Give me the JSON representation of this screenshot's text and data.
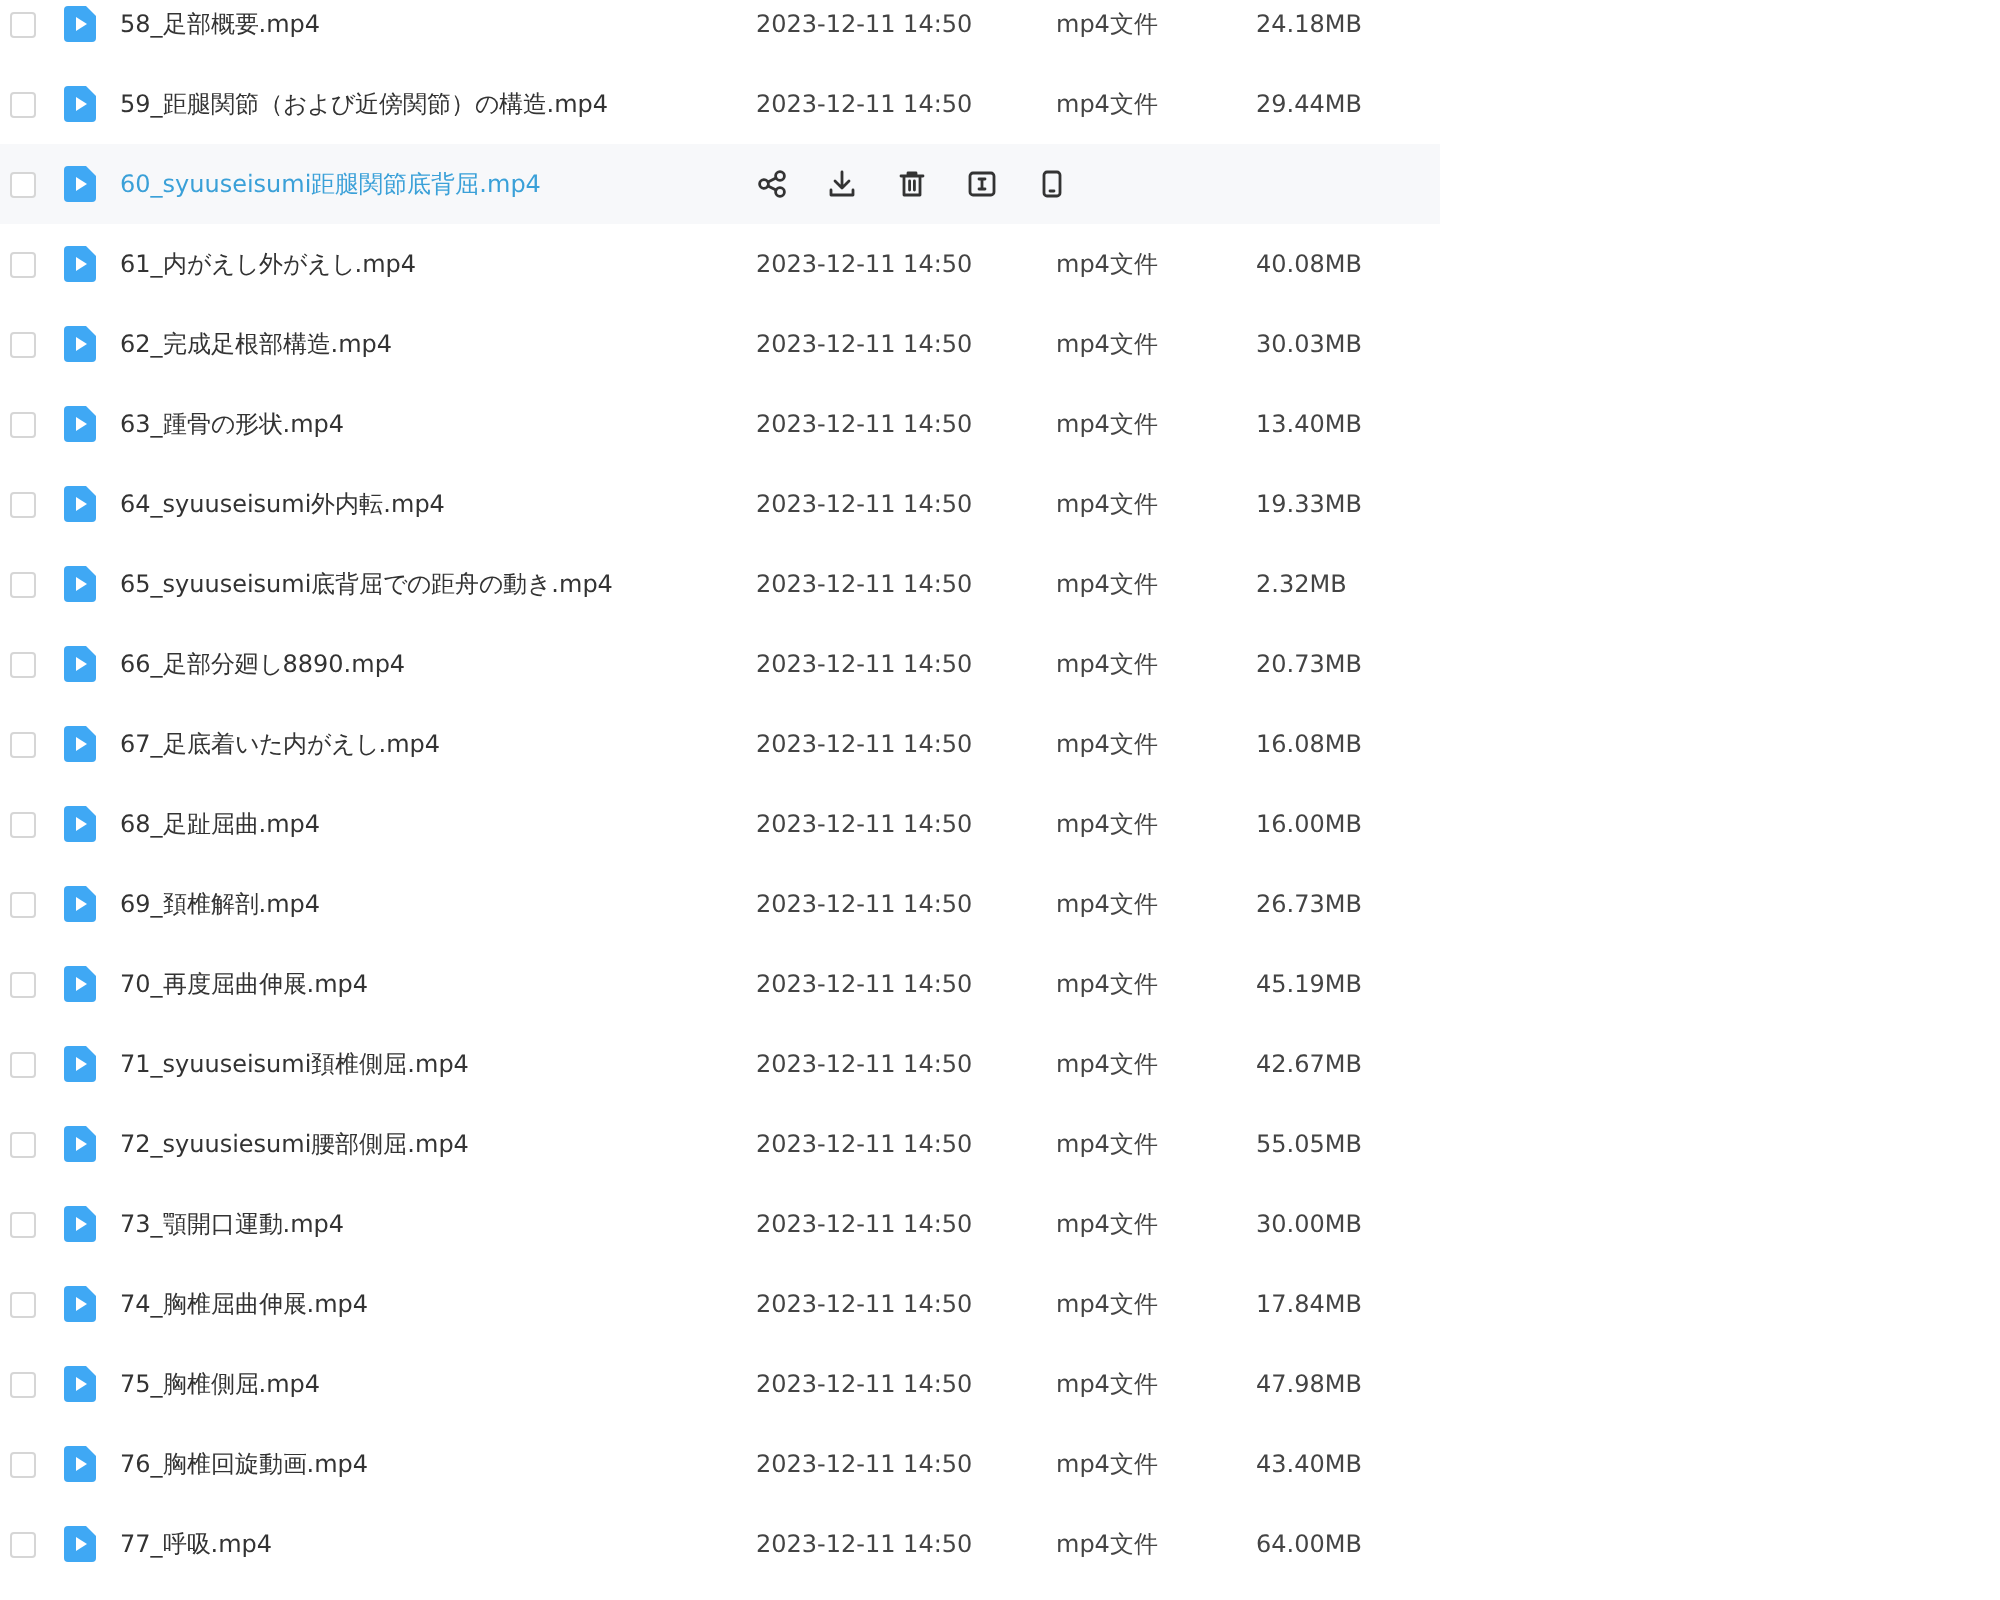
{
  "files": [
    {
      "name": "58_足部概要.mp4",
      "date": "2023-12-11 14:50",
      "type": "mp4文件",
      "size": "24.18MB",
      "hovered": false,
      "checked": false
    },
    {
      "name": "59_距腿関節（および近傍関節）の構造.mp4",
      "date": "2023-12-11 14:50",
      "type": "mp4文件",
      "size": "29.44MB",
      "hovered": false,
      "checked": false
    },
    {
      "name": "60_syuuseisumi距腿関節底背屈.mp4",
      "hovered": true,
      "checked": false
    },
    {
      "name": "61_内がえし外がえし.mp4",
      "date": "2023-12-11 14:50",
      "type": "mp4文件",
      "size": "40.08MB",
      "hovered": false,
      "checked": false
    },
    {
      "name": "62_完成足根部構造.mp4",
      "date": "2023-12-11 14:50",
      "type": "mp4文件",
      "size": "30.03MB",
      "hovered": false,
      "checked": false
    },
    {
      "name": "63_踵骨の形状.mp4",
      "date": "2023-12-11 14:50",
      "type": "mp4文件",
      "size": "13.40MB",
      "hovered": false,
      "checked": false
    },
    {
      "name": "64_syuuseisumi外内転.mp4",
      "date": "2023-12-11 14:50",
      "type": "mp4文件",
      "size": "19.33MB",
      "hovered": false,
      "checked": false
    },
    {
      "name": "65_syuuseisumi底背屈での距舟の動き.mp4",
      "date": "2023-12-11 14:50",
      "type": "mp4文件",
      "size": "2.32MB",
      "hovered": false,
      "checked": false
    },
    {
      "name": "66_足部分廻し8890.mp4",
      "date": "2023-12-11 14:50",
      "type": "mp4文件",
      "size": "20.73MB",
      "hovered": false,
      "checked": false
    },
    {
      "name": "67_足底着いた内がえし.mp4",
      "date": "2023-12-11 14:50",
      "type": "mp4文件",
      "size": "16.08MB",
      "hovered": false,
      "checked": false
    },
    {
      "name": "68_足趾屈曲.mp4",
      "date": "2023-12-11 14:50",
      "type": "mp4文件",
      "size": "16.00MB",
      "hovered": false,
      "checked": false
    },
    {
      "name": "69_頚椎解剖.mp4",
      "date": "2023-12-11 14:50",
      "type": "mp4文件",
      "size": "26.73MB",
      "hovered": false,
      "checked": false
    },
    {
      "name": "70_再度屈曲伸展.mp4",
      "date": "2023-12-11 14:50",
      "type": "mp4文件",
      "size": "45.19MB",
      "hovered": false,
      "checked": false
    },
    {
      "name": "71_syuuseisumi頚椎側屈.mp4",
      "date": "2023-12-11 14:50",
      "type": "mp4文件",
      "size": "42.67MB",
      "hovered": false,
      "checked": false
    },
    {
      "name": "72_syuusiesumi腰部側屈.mp4",
      "date": "2023-12-11 14:50",
      "type": "mp4文件",
      "size": "55.05MB",
      "hovered": false,
      "checked": false
    },
    {
      "name": "73_顎開口運動.mp4",
      "date": "2023-12-11 14:50",
      "type": "mp4文件",
      "size": "30.00MB",
      "hovered": false,
      "checked": false
    },
    {
      "name": "74_胸椎屈曲伸展.mp4",
      "date": "2023-12-11 14:50",
      "type": "mp4文件",
      "size": "17.84MB",
      "hovered": false,
      "checked": false
    },
    {
      "name": "75_胸椎側屈.mp4",
      "date": "2023-12-11 14:50",
      "type": "mp4文件",
      "size": "47.98MB",
      "hovered": false,
      "checked": false
    },
    {
      "name": "76_胸椎回旋動画.mp4",
      "date": "2023-12-11 14:50",
      "type": "mp4文件",
      "size": "43.40MB",
      "hovered": false,
      "checked": false
    },
    {
      "name": "77_呼吸.mp4",
      "date": "2023-12-11 14:50",
      "type": "mp4文件",
      "size": "64.00MB",
      "hovered": false,
      "checked": false
    }
  ]
}
